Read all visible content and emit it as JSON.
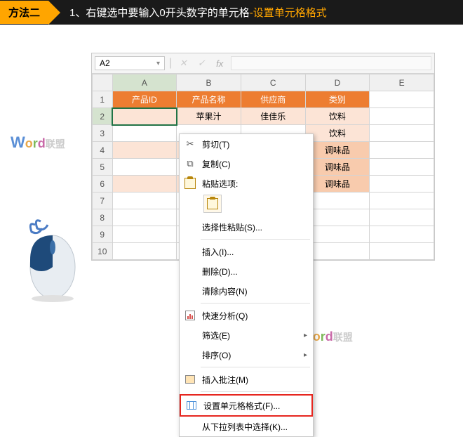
{
  "banner": {
    "tag": "方法二",
    "text_prefix": "1、右键选中要输入0开头数字的单元格",
    "text_suffix": "-设置单元格格式"
  },
  "excel": {
    "namebox": "A2",
    "fx_label": "fx",
    "columns": [
      "A",
      "B",
      "C",
      "D",
      "E"
    ],
    "rows": [
      "1",
      "2",
      "3",
      "4",
      "5",
      "6",
      "7",
      "8",
      "9",
      "10"
    ],
    "header": [
      "产品ID",
      "产品名称",
      "供应商",
      "类别",
      ""
    ],
    "data": [
      [
        "",
        "苹果汁",
        "佳佳乐",
        "饮料",
        ""
      ],
      [
        "",
        "",
        "",
        "饮料",
        ""
      ],
      [
        "",
        "",
        "",
        "调味品",
        ""
      ],
      [
        "",
        "",
        "",
        "调味品",
        ""
      ],
      [
        "",
        "",
        "",
        "调味品",
        ""
      ]
    ]
  },
  "ctx": {
    "cut": "剪切(T)",
    "copy": "复制(C)",
    "paste_opts": "粘贴选项:",
    "paste_special": "选择性粘贴(S)...",
    "insert": "插入(I)...",
    "delete": "删除(D)...",
    "clear": "清除内容(N)",
    "quick": "快速分析(Q)",
    "filter": "筛选(E)",
    "sort": "排序(O)",
    "comment": "插入批注(M)",
    "format_cells": "设置单元格格式(F)...",
    "dropdown": "从下拉列表中选择(K)..."
  },
  "icons": {
    "scissors": "✂",
    "clipboard": "📋",
    "arrow": "▸",
    "dropdown": "▾"
  }
}
